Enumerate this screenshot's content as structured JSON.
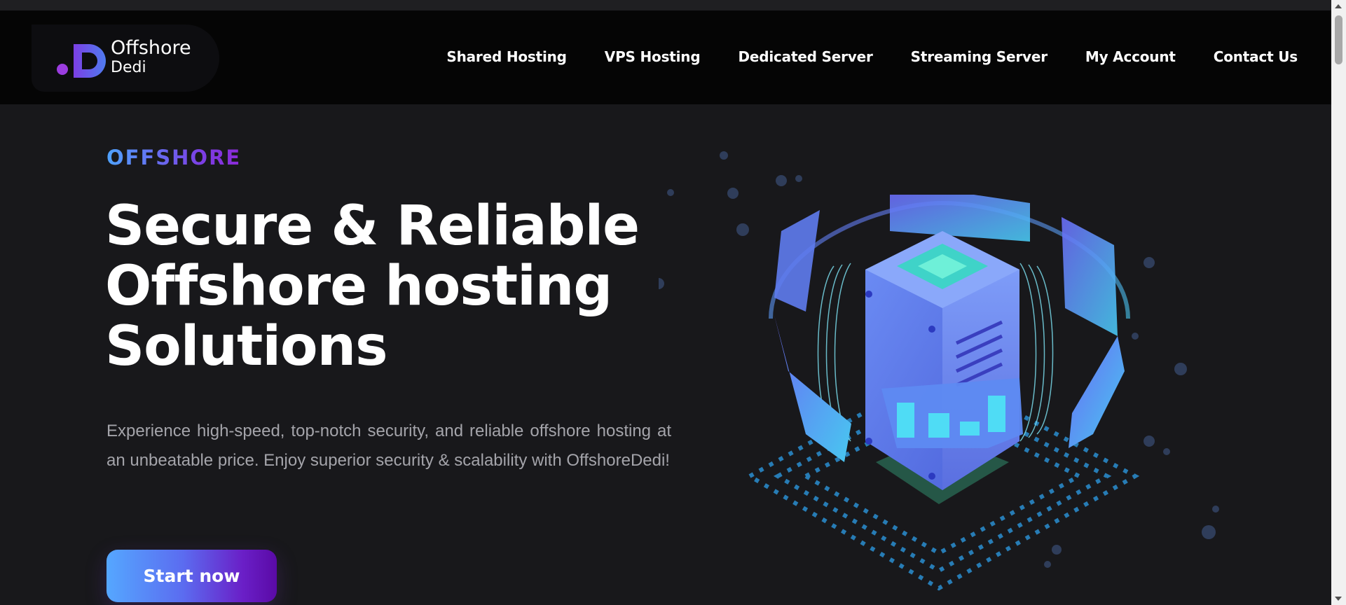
{
  "brand": {
    "mark": ".D",
    "name_line1": "Offshore",
    "name_line2": "Dedi"
  },
  "nav": [
    {
      "label": "Shared Hosting"
    },
    {
      "label": "VPS Hosting"
    },
    {
      "label": "Dedicated Server"
    },
    {
      "label": "Streaming Server"
    },
    {
      "label": "My Account"
    },
    {
      "label": "Contact Us"
    }
  ],
  "hero": {
    "eyebrow": "OFFSHORE",
    "title_line1": "Secure & Reliable",
    "title_line2": "Offshore hosting",
    "title_line3": "Solutions",
    "description": "Experience high-speed, top-notch security, and reliable offshore hosting at an unbeatable price. Enjoy superior security & scalability with OffshoreDedi!",
    "cta_label": "Start now",
    "illustration": "server-rack-icon"
  },
  "colors": {
    "page_bg": "#18181b",
    "header_bg": "#050505",
    "accent_blue": "#55a7ff",
    "accent_purple": "#6a1fc7",
    "text_muted": "#a4a4aa"
  }
}
